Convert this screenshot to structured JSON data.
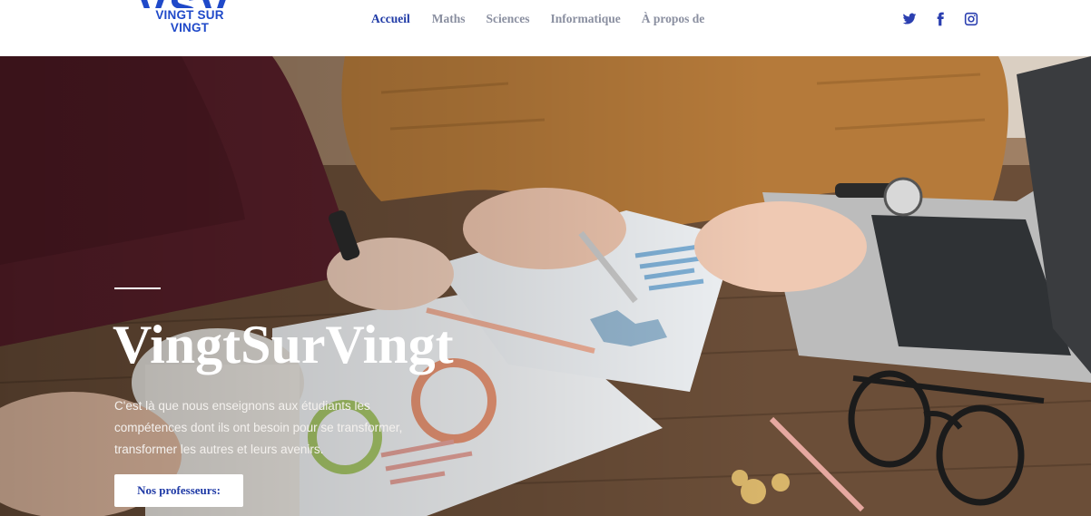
{
  "brand": {
    "logo_big": "VSV",
    "logo_small": "VINGT SUR VINGT",
    "color": "#1f49c9"
  },
  "nav": {
    "items": [
      {
        "label": "Accueil",
        "active": true
      },
      {
        "label": "Maths"
      },
      {
        "label": "Sciences"
      },
      {
        "label": "Informatique"
      },
      {
        "label": "À propos de"
      }
    ],
    "active_color": "#1f3aa6",
    "inactive_color": "#8a8fa0"
  },
  "social": {
    "icons": [
      "twitter-icon",
      "facebook-icon",
      "instagram-icon"
    ],
    "color": "#2b3fb0"
  },
  "hero": {
    "title": "VingtSurVingt",
    "text": "C'est là que nous enseignons aux étudiants les compétences dont ils ont besoin pour se transformer, transformer les autres et leurs avenirs.",
    "button_label": "Nos professeurs:"
  }
}
